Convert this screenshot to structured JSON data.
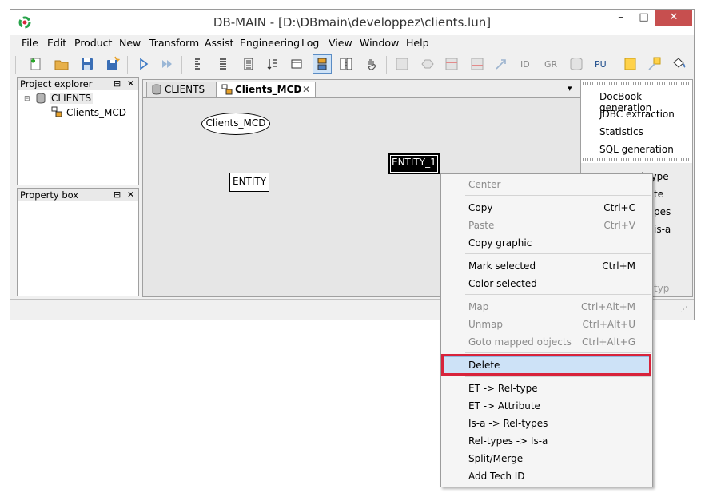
{
  "window": {
    "title": "DB-MAIN  - [D:\\DBmain\\developpez\\clients.lun]",
    "controls": {
      "minimize": "–",
      "maximize": "□",
      "close": "✕"
    }
  },
  "menubar": [
    "File",
    "Edit",
    "Product",
    "New",
    "Transform",
    "Assist",
    "Engineering",
    "Log",
    "View",
    "Window",
    "Help"
  ],
  "toolbar": {
    "text_buttons": [
      "ID",
      "GR",
      "PU"
    ]
  },
  "project_explorer": {
    "title": "Project explorer",
    "controls": {
      "restore": "⊟",
      "close": "✕"
    },
    "root": "CLIENTS",
    "child": "Clients_MCD"
  },
  "property_box": {
    "title": "Property box",
    "controls": {
      "restore": "⊟",
      "close": "✕"
    }
  },
  "editor": {
    "tabs": [
      {
        "label": "CLIENTS",
        "active": false
      },
      {
        "label": "Clients_MCD",
        "active": true,
        "close": "✕"
      }
    ],
    "dropdown": "▾",
    "canvas": {
      "schema_label": "Clients_MCD",
      "entities": [
        "ENTITY",
        "ENTITY_1"
      ]
    }
  },
  "right_panel": {
    "items_top": [
      "DocBook generation",
      "JDBC extraction",
      "Statistics",
      "SQL generation"
    ],
    "items_bottom": [
      "ET -> Rel-type",
      "te",
      "pes",
      "is-a",
      "typ"
    ]
  },
  "context_menu": {
    "items": [
      {
        "label": "Center",
        "shortcut": "",
        "disabled": true
      },
      {
        "label": "Copy",
        "shortcut": "Ctrl+C",
        "disabled": false
      },
      {
        "label": "Paste",
        "shortcut": "Ctrl+V",
        "disabled": true
      },
      {
        "label": "Copy graphic",
        "shortcut": "",
        "disabled": false
      },
      {
        "label": "Mark selected",
        "shortcut": "Ctrl+M",
        "disabled": false
      },
      {
        "label": "Color selected",
        "shortcut": "",
        "disabled": false
      },
      {
        "label": "Map",
        "shortcut": "Ctrl+Alt+M",
        "disabled": true
      },
      {
        "label": "Unmap",
        "shortcut": "Ctrl+Alt+U",
        "disabled": true
      },
      {
        "label": "Goto mapped objects",
        "shortcut": "Ctrl+Alt+G",
        "disabled": true
      },
      {
        "label": "Delete",
        "shortcut": "",
        "disabled": false,
        "highlighted": true
      },
      {
        "label": "ET -> Rel-type",
        "shortcut": "",
        "disabled": false
      },
      {
        "label": "ET -> Attribute",
        "shortcut": "",
        "disabled": false
      },
      {
        "label": "Is-a -> Rel-types",
        "shortcut": "",
        "disabled": false
      },
      {
        "label": "Rel-types -> Is-a",
        "shortcut": "",
        "disabled": false
      },
      {
        "label": "Split/Merge",
        "shortcut": "",
        "disabled": false
      },
      {
        "label": "Add Tech ID",
        "shortcut": "",
        "disabled": false
      }
    ]
  },
  "colors": {
    "highlight_border": "#d8233b",
    "selected_item": "#cde2f7",
    "close_button": "#c74f4f"
  }
}
